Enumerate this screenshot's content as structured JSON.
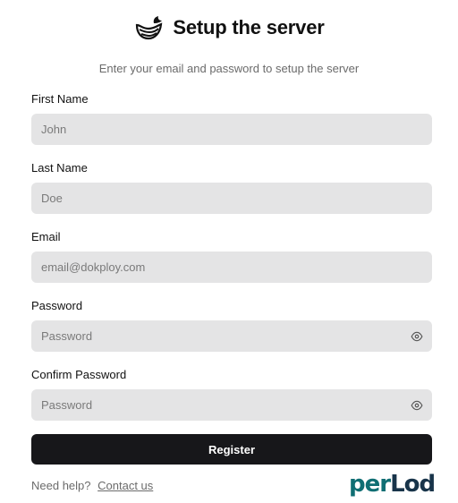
{
  "header": {
    "title": "Setup the server",
    "logo_icon": "whale-logo-icon"
  },
  "subtitle": "Enter your email and password to setup the server",
  "form": {
    "first_name": {
      "label": "First Name",
      "placeholder": "John"
    },
    "last_name": {
      "label": "Last Name",
      "placeholder": "Doe"
    },
    "email": {
      "label": "Email",
      "placeholder": "email@dokploy.com"
    },
    "password": {
      "label": "Password",
      "placeholder": "Password",
      "icon": "eye-icon"
    },
    "confirm_password": {
      "label": "Confirm Password",
      "placeholder": "Password",
      "icon": "eye-icon"
    },
    "register_label": "Register"
  },
  "footer": {
    "help_text": "Need help?",
    "contact_link": "Contact us"
  },
  "watermark": {
    "text": "perLod"
  },
  "colors": {
    "input_bg": "#e4e4e5",
    "button_bg": "#17171a",
    "muted_text": "#6b6b6b",
    "brand_teal": "#0f6e73",
    "brand_dark": "#18344a"
  }
}
